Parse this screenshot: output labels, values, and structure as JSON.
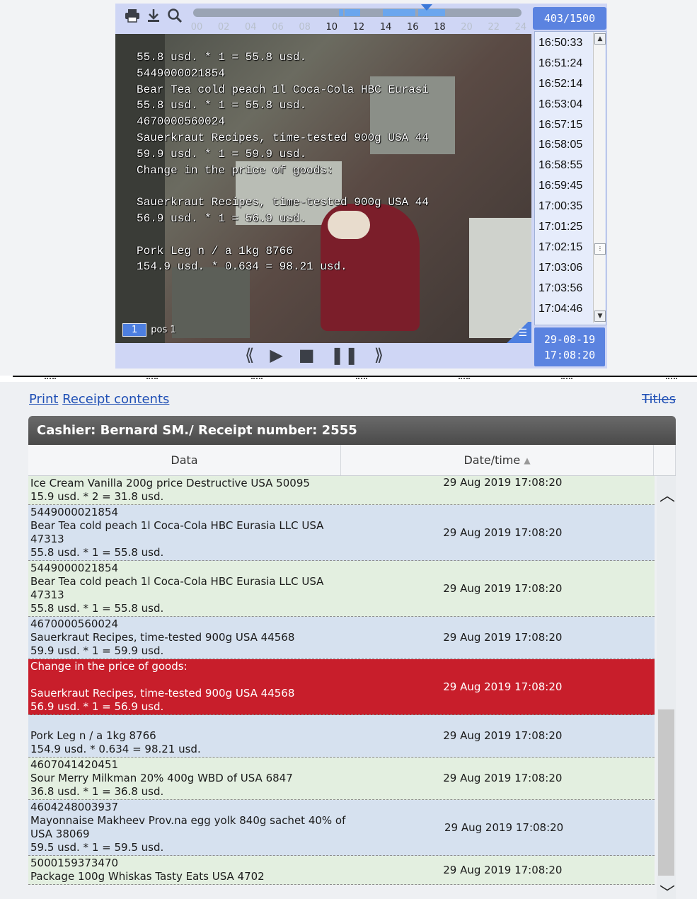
{
  "player": {
    "counter": "403/1500",
    "hours": [
      "00",
      "02",
      "04",
      "06",
      "08",
      "10",
      "12",
      "14",
      "16",
      "18",
      "20",
      "22",
      "24"
    ],
    "camera_number": "1",
    "camera_position": "pos 1",
    "overlay_text": "55.8 usd. * 1 = 55.8 usd.\n5449000021854\nBear Tea cold peach 1l Coca-Cola HBC Eurasi\n55.8 usd. * 1 = 55.8 usd.\n4670000560024\nSauerkraut Recipes, time-tested 900g USA 44\n59.9 usd. * 1 = 59.9 usd.\nChange in the price of goods:\n\nSauerkraut Recipes, time-tested 900g USA 44\n56.9 usd. * 1 = 56.9 usd.\n\nPork Leg n / a 1kg 8766\n154.9 usd. * 0.634 = 98.21 usd.",
    "times": [
      "16:50:33",
      "16:51:24",
      "16:52:14",
      "16:53:04",
      "16:57:15",
      "16:58:05",
      "16:58:55",
      "16:59:45",
      "17:00:35",
      "17:01:25",
      "17:02:15",
      "17:03:06",
      "17:03:56",
      "17:04:46"
    ],
    "current_date": "29-08-19",
    "current_time": "17:08:20"
  },
  "links": {
    "print": "Print",
    "receipt_contents": "Receipt contents",
    "titles": "Titles"
  },
  "receipt": {
    "header": "Cashier: Bernard SM./ Receipt number: 2555",
    "col_data": "Data",
    "col_datetime": "Date/time",
    "rows": [
      {
        "style": "green",
        "lines": [
          "Ice Cream Vanilla 200g price Destructive USA 50095",
          "15.9 usd. * 2 = 31.8 usd."
        ],
        "datetime": "29 Aug 2019 17:08:20",
        "date_top": true
      },
      {
        "style": "blue",
        "lines": [
          "5449000021854",
          "Bear Tea cold peach 1l Coca-Cola HBC Eurasia LLC USA",
          "47313",
          "55.8 usd. * 1 = 55.8 usd."
        ],
        "datetime": "29 Aug 2019 17:08:20"
      },
      {
        "style": "green",
        "lines": [
          "5449000021854",
          "Bear Tea cold peach 1l Coca-Cola HBC Eurasia LLC USA",
          "47313",
          "55.8 usd. * 1 = 55.8 usd."
        ],
        "datetime": "29 Aug 2019 17:08:20"
      },
      {
        "style": "blue",
        "lines": [
          "4670000560024",
          "Sauerkraut Recipes, time-tested 900g USA 44568",
          "59.9 usd. * 1 = 59.9 usd."
        ],
        "datetime": "29 Aug 2019 17:08:20"
      },
      {
        "style": "red",
        "lines": [
          "Change in the price of goods:",
          "",
          "Sauerkraut Recipes, time-tested 900g USA 44568",
          "56.9 usd. * 1 = 56.9 usd."
        ],
        "datetime": "29 Aug 2019 17:08:20"
      },
      {
        "style": "blue",
        "lines": [
          "",
          "Pork Leg n / a 1kg 8766",
          "154.9 usd. * 0.634 = 98.21 usd."
        ],
        "datetime": "29 Aug 2019 17:08:20"
      },
      {
        "style": "green",
        "lines": [
          "4607041420451",
          "Sour Merry Milkman 20% 400g WBD of USA 6847",
          "36.8 usd. * 1 = 36.8 usd."
        ],
        "datetime": "29 Aug 2019 17:08:20"
      },
      {
        "style": "blue",
        "lines": [
          "4604248003937",
          "Mayonnaise Makheev Prov.na egg yolk 840g sachet 40% of",
          "USA 38069",
          "59.5 usd. * 1 = 59.5 usd."
        ],
        "datetime": "29 Aug 2019 17:08:20"
      },
      {
        "style": "green",
        "lines": [
          "5000159373470",
          "Package 100g Whiskas Tasty Eats USA 4702"
        ],
        "datetime": "29 Aug 2019 17:08:20"
      }
    ]
  },
  "icons": {
    "print": "printer-icon",
    "download": "download-icon",
    "search": "magnifier-icon"
  },
  "colors": {
    "accent": "#5b83e0",
    "highlight_row": "#c81e2b",
    "row_green": "#e3efe0",
    "row_blue": "#d6e1ef"
  }
}
